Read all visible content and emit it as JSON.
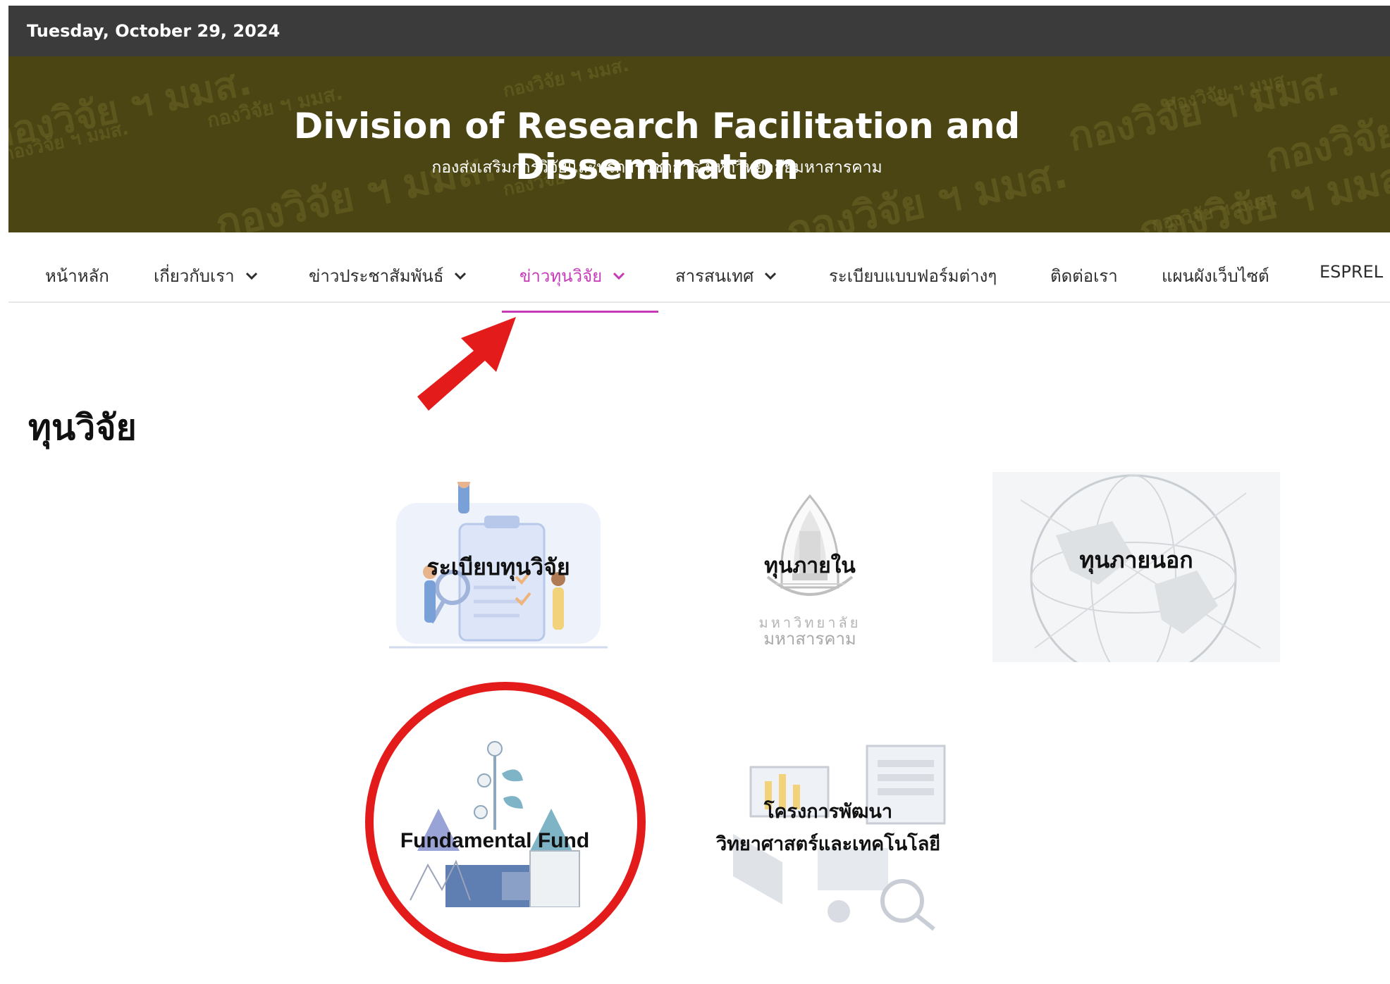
{
  "topbar": {
    "date": "Tuesday, October 29, 2024"
  },
  "banner": {
    "title": "Division of Research Facilitation and Dissemination",
    "subtitle": "กองส่งเสริมการวิจัยและบริการวิชาการ มหาวิทยาลัยมหาสารคาม",
    "watermark_large": "กองวิจัย ฯ มมส.",
    "watermark_small": "กองวิจัย ฯ มมส."
  },
  "nav": {
    "items": [
      {
        "label": "หน้าหลัก",
        "dropdown": false,
        "active": false
      },
      {
        "label": "เกี่ยวกับเรา",
        "dropdown": true,
        "active": false
      },
      {
        "label": "ข่าวประชาสัมพันธ์",
        "dropdown": true,
        "active": false
      },
      {
        "label": "ข่าวทุนวิจัย",
        "dropdown": true,
        "active": true
      },
      {
        "label": "สารสนเทศ",
        "dropdown": true,
        "active": false
      },
      {
        "label": "ระเบียบแบบฟอร์มต่างๆ",
        "dropdown": false,
        "active": false
      },
      {
        "label": "ติดต่อเรา",
        "dropdown": false,
        "active": false
      },
      {
        "label": "แผนผังเว็บไซต์",
        "dropdown": false,
        "active": false
      },
      {
        "label": "ESPREL",
        "dropdown": false,
        "active": false
      }
    ]
  },
  "main": {
    "title": "ทุนวิจัย",
    "cards": [
      {
        "label": "ระเบียบทุนวิจัย"
      },
      {
        "label": "ทุนภายใน",
        "caption_line1": "มหาวิทยาลัย",
        "caption_line2": "มหาสารคาม"
      },
      {
        "label": "ทุนภายนอก"
      },
      {
        "label": "Fundamental Fund"
      },
      {
        "label_line1": "โครงการพัฒนา",
        "label_line2": "วิทยาศาสตร์และเทคโนโลยี"
      }
    ]
  },
  "colors": {
    "topbar": "#3b3b3b",
    "banner": "#4a4513",
    "nav_active": "#c53ab8",
    "annotation_red": "#e31b1b"
  },
  "annotations": {
    "arrow": "red-arrow-icon",
    "circle": "red-highlight-circle"
  }
}
